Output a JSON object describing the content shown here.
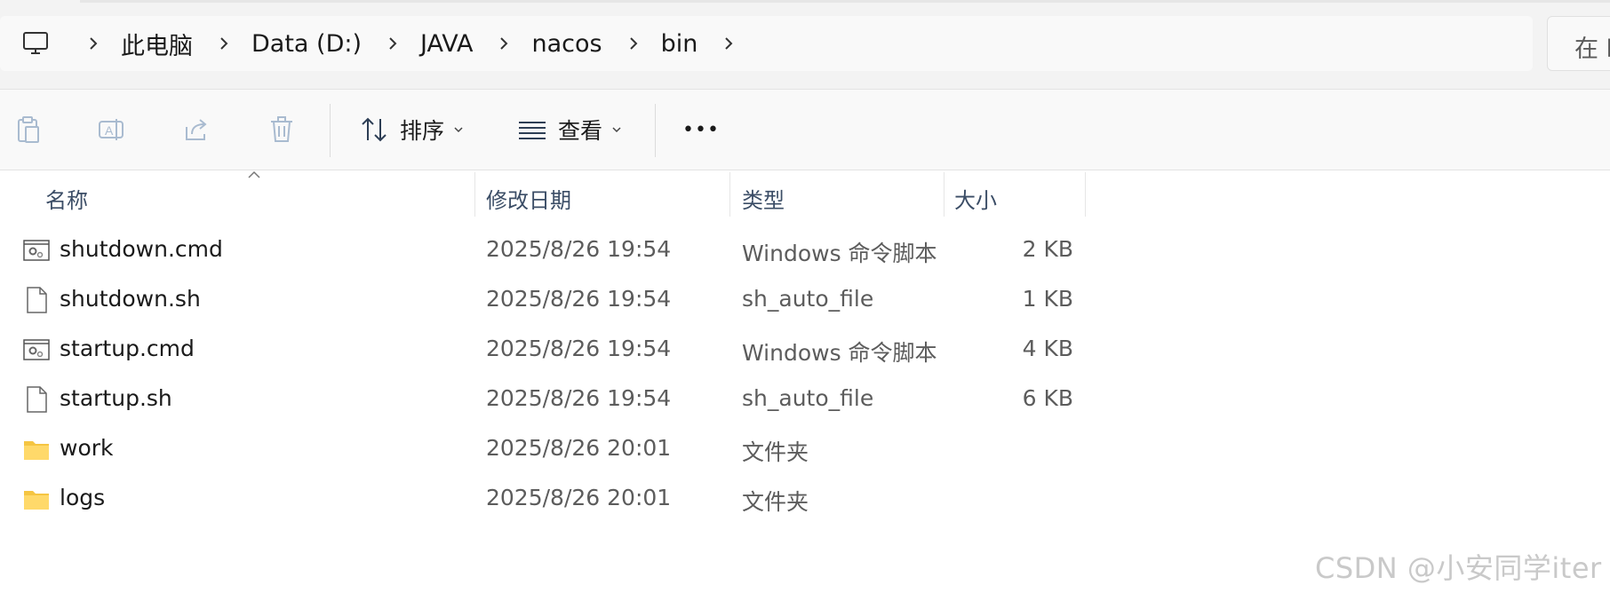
{
  "address_bar": {
    "crumbs": [
      "此电脑",
      "Data (D:)",
      "JAVA",
      "nacos",
      "bin"
    ],
    "search_text": "在 b"
  },
  "toolbar": {
    "sort_label": "排序",
    "view_label": "查看",
    "more_label": "•••"
  },
  "columns": {
    "name": "名称",
    "date": "修改日期",
    "type": "类型",
    "size": "大小"
  },
  "files": [
    {
      "name": "shutdown.cmd",
      "date": "2025/8/26 19:54",
      "type": "Windows 命令脚本",
      "size": "2 KB",
      "icon": "cmd-script-icon"
    },
    {
      "name": "shutdown.sh",
      "date": "2025/8/26 19:54",
      "type": "sh_auto_file",
      "size": "1 KB",
      "icon": "blank-file-icon"
    },
    {
      "name": "startup.cmd",
      "date": "2025/8/26 19:54",
      "type": "Windows 命令脚本",
      "size": "4 KB",
      "icon": "cmd-script-icon"
    },
    {
      "name": "startup.sh",
      "date": "2025/8/26 19:54",
      "type": "sh_auto_file",
      "size": "6 KB",
      "icon": "blank-file-icon"
    },
    {
      "name": "work",
      "date": "2025/8/26 20:01",
      "type": "文件夹",
      "size": "",
      "icon": "folder-icon"
    },
    {
      "name": "logs",
      "date": "2025/8/26 20:01",
      "type": "文件夹",
      "size": "",
      "icon": "folder-icon"
    }
  ],
  "watermark": "CSDN @小安同学iter",
  "colors": {
    "folder": "#f5c542",
    "header_text": "#3b4d66",
    "disabled_icon": "#a9bbd0"
  }
}
